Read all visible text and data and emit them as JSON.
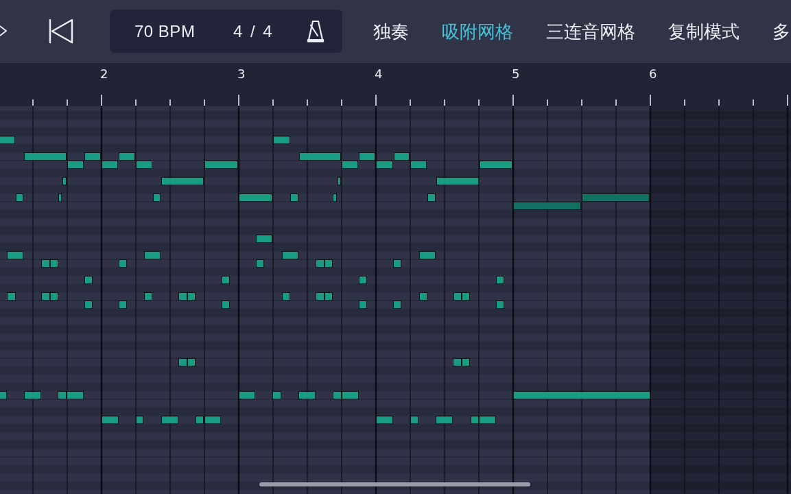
{
  "toolbar": {
    "tempo": "70 BPM",
    "time_signature": "4 / 4",
    "modes": [
      {
        "label": "独奏",
        "on": false
      },
      {
        "label": "吸附网格",
        "on": true
      },
      {
        "label": "三连音网格",
        "on": false
      },
      {
        "label": "复制模式",
        "on": false
      },
      {
        "label": "多",
        "on": false
      }
    ]
  },
  "ruler": {
    "bar_numbers": [
      "2",
      "3",
      "4",
      "5",
      "6"
    ]
  }
}
